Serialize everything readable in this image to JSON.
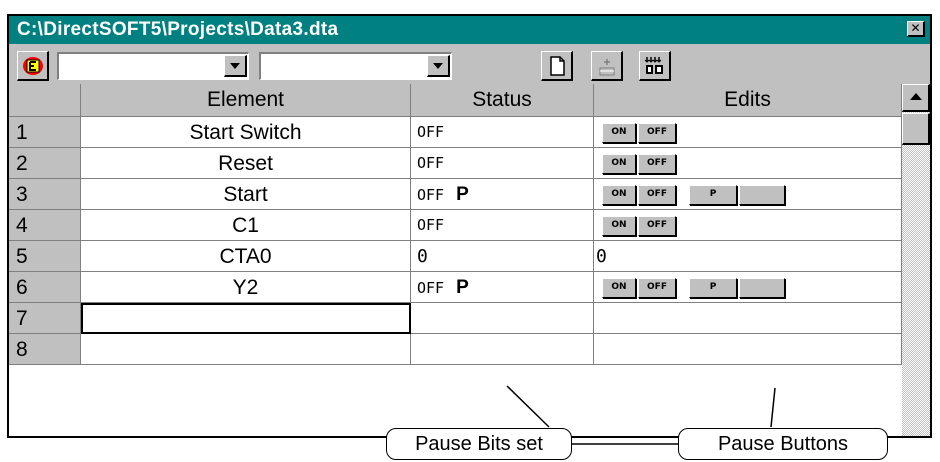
{
  "window": {
    "title": "C:\\DirectSOFT5\\Projects\\Data3.dta",
    "close_glyph": "✕"
  },
  "toolbar": {
    "icons": [
      "element-mode-icon",
      "new-page-icon",
      "insert-element-icon",
      "display-format-icon"
    ],
    "combo1_value": "",
    "combo2_value": ""
  },
  "grid": {
    "headers": {
      "element": "Element",
      "status": "Status",
      "edits": "Edits"
    },
    "rows": [
      {
        "num": "1",
        "element": "Start Switch",
        "status": "OFF",
        "pause": "",
        "edit_type": "onoff"
      },
      {
        "num": "2",
        "element": "Reset",
        "status": "OFF",
        "pause": "",
        "edit_type": "onoff"
      },
      {
        "num": "3",
        "element": "Start",
        "status": "OFF",
        "pause": "P",
        "edit_type": "onoff_pause"
      },
      {
        "num": "4",
        "element": "C1",
        "status": "OFF",
        "pause": "",
        "edit_type": "onoff"
      },
      {
        "num": "5",
        "element": "CTA0",
        "status": "0",
        "pause": "",
        "edit_type": "value",
        "edit_value": "0"
      },
      {
        "num": "6",
        "element": "Y2",
        "status": "OFF",
        "pause": "P",
        "edit_type": "onoff_pause"
      },
      {
        "num": "7",
        "element": "",
        "status": "",
        "pause": "",
        "edit_type": "empty"
      },
      {
        "num": "8",
        "element": "",
        "status": "",
        "pause": "",
        "edit_type": "empty"
      }
    ],
    "button_labels": {
      "on": "ON",
      "off": "OFF",
      "pause": "P"
    }
  },
  "annotations": {
    "pause_bits": "Pause Bits set",
    "pause_buttons": "Pause Buttons"
  }
}
